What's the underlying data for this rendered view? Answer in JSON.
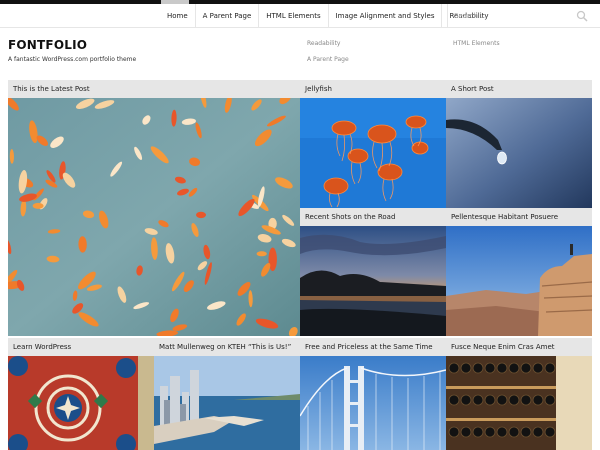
{
  "nav": {
    "items": [
      {
        "label": "Home"
      },
      {
        "label": "A Parent Page"
      },
      {
        "label": "HTML Elements"
      },
      {
        "label": "Image Alignment and Styles"
      },
      {
        "label": "Readability"
      }
    ],
    "search_placeholder": "Search …"
  },
  "header": {
    "title": "FONTFOLIO",
    "description": "A fantastic WordPress.com portfolio theme",
    "links": {
      "readability": "Readability",
      "html_elements": "HTML Elements",
      "parent_page": "A Parent Page"
    }
  },
  "posts": [
    {
      "title": "This is the Latest Post"
    },
    {
      "title": "Jellyfish"
    },
    {
      "title": "A Short Post"
    },
    {
      "title": "Recent Shots on the Road"
    },
    {
      "title": "Pellentesque Habitant Posuere"
    },
    {
      "title": "Learn WordPress"
    },
    {
      "title": "Matt Mullenweg on KTEH “This is Us!”"
    },
    {
      "title": "Free and Priceless at the Same Time"
    },
    {
      "title": "Fusce Neque Enim Cras Amet"
    }
  ]
}
